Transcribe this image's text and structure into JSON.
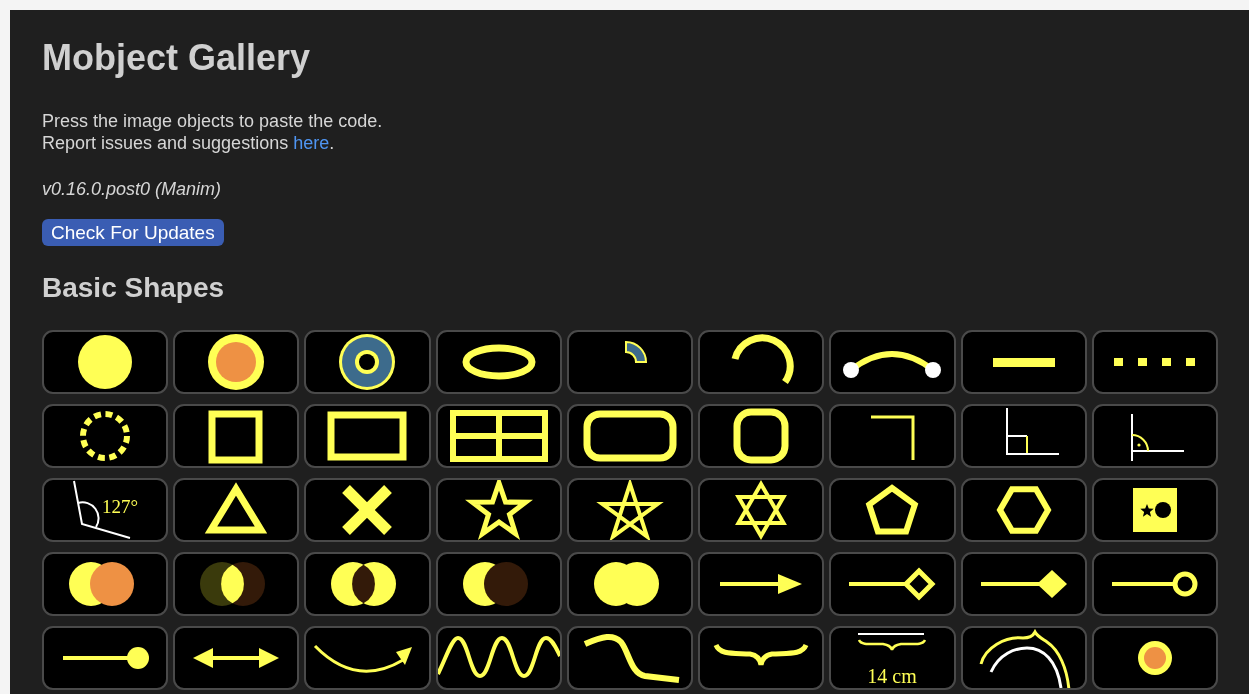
{
  "title": "Mobject Gallery",
  "intro": {
    "line_1": "Press the image objects to paste the code.",
    "line_2_before": "Report issues and suggestions ",
    "link": "here",
    "line_2_after": "."
  },
  "version": "v0.16.0.post0 (Manim)",
  "update_button": "Check For Updates",
  "section": {
    "title": "Basic Shapes",
    "tiles": [
      {
        "kind": "dot"
      },
      {
        "kind": "ring-orange"
      },
      {
        "kind": "annulus"
      },
      {
        "kind": "ellipse"
      },
      {
        "kind": "sector"
      },
      {
        "kind": "arc"
      },
      {
        "kind": "arc-between-points"
      },
      {
        "kind": "line"
      },
      {
        "kind": "dashed-line"
      },
      {
        "kind": "dashed-circle"
      },
      {
        "kind": "square"
      },
      {
        "kind": "rectangle"
      },
      {
        "kind": "grid"
      },
      {
        "kind": "rounded-rectangle"
      },
      {
        "kind": "rounded-square"
      },
      {
        "kind": "elbow"
      },
      {
        "kind": "right-angle"
      },
      {
        "kind": "angle"
      },
      {
        "kind": "angle-label",
        "label": "127°"
      },
      {
        "kind": "triangle"
      },
      {
        "kind": "cross"
      },
      {
        "kind": "star"
      },
      {
        "kind": "pentagram"
      },
      {
        "kind": "hexagram"
      },
      {
        "kind": "pentagon"
      },
      {
        "kind": "hexagon"
      },
      {
        "kind": "symbol-square"
      },
      {
        "kind": "union"
      },
      {
        "kind": "intersection"
      },
      {
        "kind": "exclusion"
      },
      {
        "kind": "difference"
      },
      {
        "kind": "merged"
      },
      {
        "kind": "arrow"
      },
      {
        "kind": "diamond-tip"
      },
      {
        "kind": "filled-diamond-tip"
      },
      {
        "kind": "circle-tip"
      },
      {
        "kind": "dot-tip"
      },
      {
        "kind": "double-arrow"
      },
      {
        "kind": "curved-arrow"
      },
      {
        "kind": "sine"
      },
      {
        "kind": "s-curve"
      },
      {
        "kind": "brace"
      },
      {
        "kind": "brace-label",
        "label": "14 cm"
      },
      {
        "kind": "arc-brace"
      },
      {
        "kind": "small-ring"
      }
    ]
  }
}
